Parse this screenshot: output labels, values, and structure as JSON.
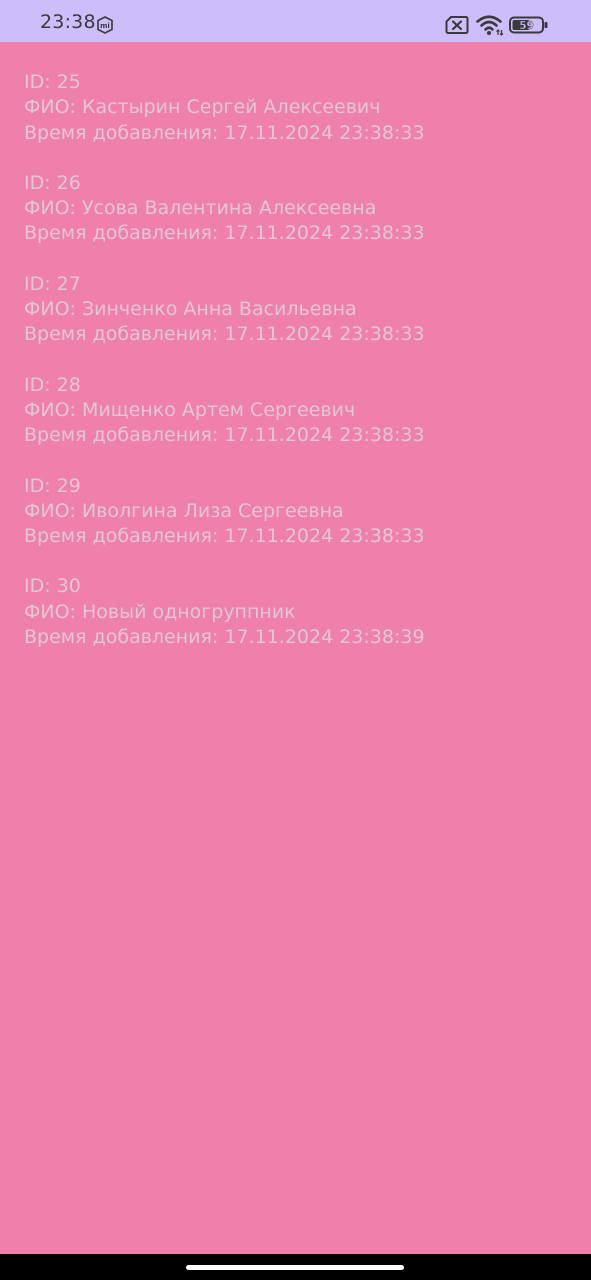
{
  "status_bar": {
    "time": "23:38",
    "battery_level": "59",
    "mi_badge_text": "mi",
    "icons": [
      "mi-icon",
      "sim-x-icon",
      "wifi-icon",
      "battery-icon"
    ],
    "background_color": "#CDBEFB"
  },
  "colors": {
    "background": "#EF80A9",
    "text": "#E4C6D4",
    "status_text": "#3A3A3A"
  },
  "records": [
    {
      "id": "ID: 25",
      "name": "ФИО: Кастырин Сергей Алексеевич",
      "time": "Время добавления: 17.11.2024 23:38:33"
    },
    {
      "id": "ID: 26",
      "name": "ФИО: Усова Валентина Алексеевна",
      "time": "Время добавления: 17.11.2024 23:38:33"
    },
    {
      "id": "ID: 27",
      "name": "ФИО: Зинченко Анна Васильевна",
      "time": "Время добавления: 17.11.2024 23:38:33"
    },
    {
      "id": "ID: 28",
      "name": "ФИО: Мищенко Артем Сергеевич",
      "time": "Время добавления: 17.11.2024 23:38:33"
    },
    {
      "id": "ID: 29",
      "name": "ФИО: Иволгина Лиза Сергеевна",
      "time": "Время добавления: 17.11.2024 23:38:33"
    },
    {
      "id": "ID: 30",
      "name": "ФИО: Новый одногруппник",
      "time": "Время добавления: 17.11.2024 23:38:39"
    }
  ]
}
